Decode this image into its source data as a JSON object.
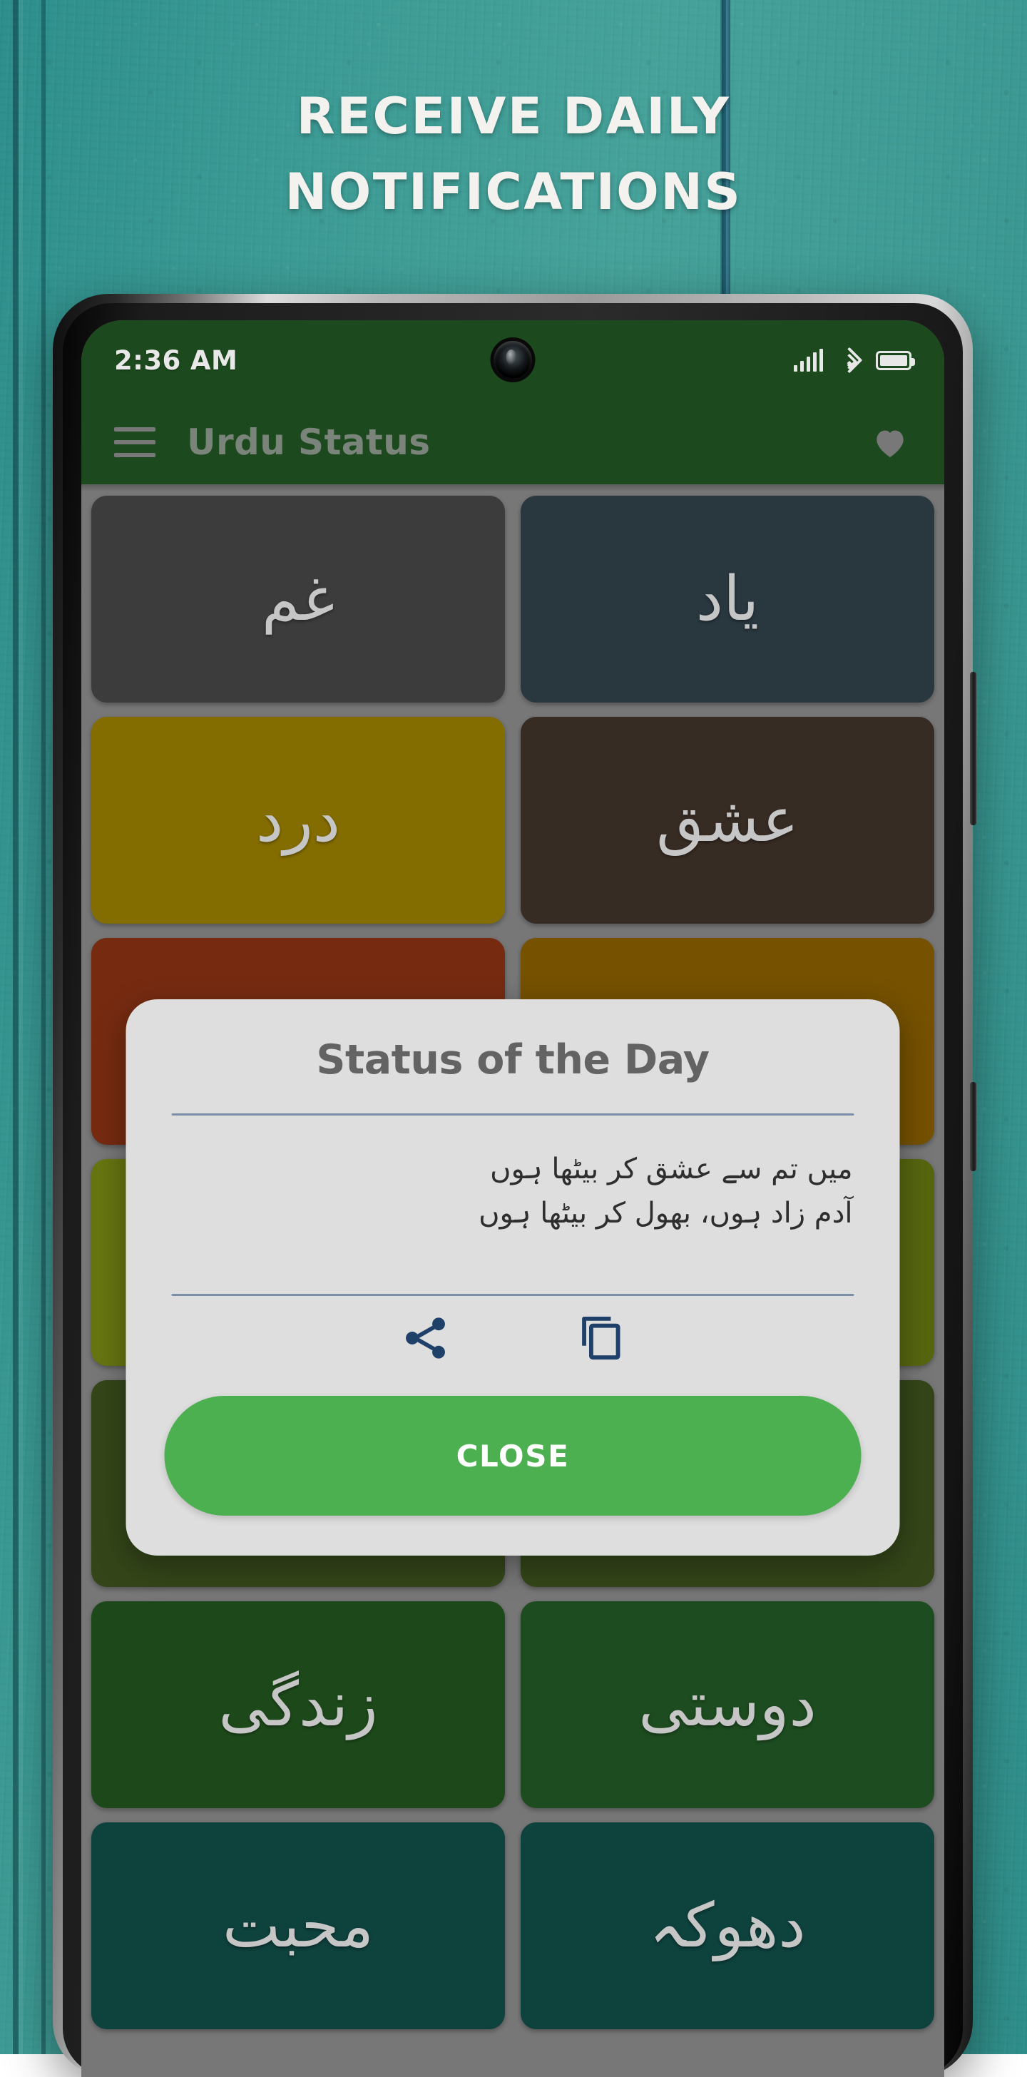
{
  "promo": {
    "headline_line1": "RECEIVE DAILY",
    "headline_line2": "NOTIFICATIONS",
    "background_color": "#3c9b95"
  },
  "statusbar": {
    "time": "2:36 AM",
    "icons": [
      "signal-bars-icon",
      "wifi-icon",
      "battery-icon"
    ],
    "background_color": "#1e4d1f"
  },
  "appbar": {
    "menu_icon": "hamburger-menu-icon",
    "title": "Urdu Status",
    "favorite_icon": "heart-icon",
    "background_color": "#1e4d1f",
    "title_color": "#7f8a7f"
  },
  "grid": {
    "background_color": "#7c7c7c",
    "tiles": [
      {
        "label": "غم",
        "color": "#3f3f3f"
      },
      {
        "label": "یاد",
        "color": "#2b3a42"
      },
      {
        "label": "درد",
        "color": "#8a7200"
      },
      {
        "label": "عشق",
        "color": "#3a2e26"
      },
      {
        "label": "",
        "color": "#7b2d12"
      },
      {
        "label": "",
        "color": "#7a5500"
      },
      {
        "label": "",
        "color": "#6c7a12"
      },
      {
        "label": "",
        "color": "#5a6b10"
      },
      {
        "label": "",
        "color": "#37491b"
      },
      {
        "label": "",
        "color": "#37491b"
      },
      {
        "label": "زندگی",
        "color": "#1f4d1c"
      },
      {
        "label": "دوستی",
        "color": "#1f5022"
      },
      {
        "label": "محبت",
        "color": "#0f4540"
      },
      {
        "label": "دھوکہ",
        "color": "#0f4540"
      }
    ]
  },
  "dialog": {
    "title": "Status of the Day",
    "line1": "میں تم سے عشق کر بیٹھا ہوں",
    "line2": "آدم زاد ہوں، بھول کر بیٹھا ہوں",
    "share_icon": "share-icon",
    "copy_icon": "copy-icon",
    "close_label": "CLOSE",
    "close_color": "#4caf50",
    "background_color": "#dedede",
    "icon_color": "#1f4068"
  }
}
